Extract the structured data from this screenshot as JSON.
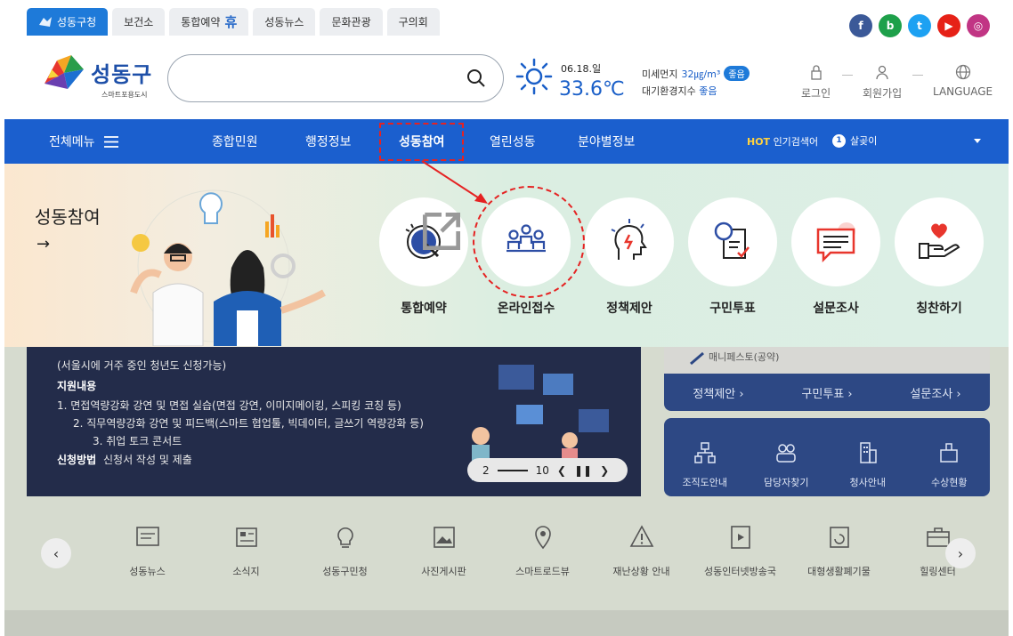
{
  "colors": {
    "primary": "#1b5fce",
    "highlight": "#e52222"
  },
  "top_tabs": [
    {
      "label": "성동구청",
      "active": true
    },
    {
      "label": "보건소"
    },
    {
      "label": "통합예약",
      "badge": "휴"
    },
    {
      "label": "성동뉴스"
    },
    {
      "label": "문화관광"
    },
    {
      "label": "구의회"
    }
  ],
  "social": [
    {
      "icon": "facebook-icon",
      "glyph": "f",
      "color": "#3b5998"
    },
    {
      "icon": "blog-icon",
      "glyph": "b",
      "color": "#1ea04a"
    },
    {
      "icon": "twitter-icon",
      "glyph": "t",
      "color": "#1da1f2"
    },
    {
      "icon": "youtube-icon",
      "glyph": "▶",
      "color": "#e62117"
    },
    {
      "icon": "instagram-icon",
      "glyph": "◎",
      "color": "#c13584"
    }
  ],
  "logo": {
    "name": "성동구",
    "subtitle": "스마트포용도시"
  },
  "search": {
    "placeholder": ""
  },
  "weather": {
    "date": "06.18.일",
    "temp": "33.6℃"
  },
  "air": {
    "dust_label": "미세먼지",
    "dust_value": "32㎍/m³",
    "dust_grade": "좋음",
    "index_label": "대기환경지수",
    "index_value": "좋음"
  },
  "utility": {
    "login": "로그인",
    "join": "회원가입",
    "language": "LANGUAGE"
  },
  "nav": {
    "all_menu": "전체메뉴",
    "items": [
      "종합민원",
      "행정정보",
      "성동참여",
      "열린성동",
      "분야별정보"
    ],
    "active_index": 2,
    "hot_prefix": "HOT",
    "hot_label": "인기검색어",
    "hot_rank": "1",
    "hot_keyword": "살곶이"
  },
  "mega": {
    "title": "성동참여",
    "items": [
      {
        "label": "통합예약",
        "icon": "reservation-icon",
        "external": true
      },
      {
        "label": "온라인접수",
        "icon": "online-reception-icon",
        "highlighted": true
      },
      {
        "label": "정책제안",
        "icon": "policy-proposal-icon"
      },
      {
        "label": "구민투표",
        "icon": "resident-vote-icon"
      },
      {
        "label": "설문조사",
        "icon": "survey-icon"
      },
      {
        "label": "칭찬하기",
        "icon": "praise-icon"
      }
    ]
  },
  "banner": {
    "lines": [
      "(서울시에 거주 중인 청년도 신청가능)",
      "지원내용",
      "1. 면접역량강화 강연 및 면접 실습(면접 강연, 이미지메이킹, 스피킹 코칭 등)",
      "2. 직무역량강화 강연 및 피드백(스마트 협업툴, 빅데이터, 글쓰기 역량강화 등)",
      "3. 취업 토크 콘서트",
      "신청방법",
      "신청서 작성 및 제출"
    ],
    "pager_current": "2",
    "pager_total": "10"
  },
  "right_panel": {
    "manifesto": "매니페스토(공약)",
    "links": [
      "정책제안 ›",
      "구민투표 ›",
      "설문조사 ›"
    ],
    "tiles": [
      "조직도안내",
      "담당자찾기",
      "청사안내",
      "수상현황"
    ]
  },
  "quick_links": [
    "성동뉴스",
    "소식지",
    "성동구민청",
    "사진게시판",
    "스마트로드뷰",
    "재난상황 안내",
    "성동인터넷방송국",
    "대형생활폐기물",
    "힐링센터"
  ]
}
